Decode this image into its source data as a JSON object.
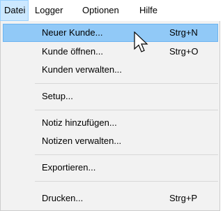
{
  "menubar": {
    "items": [
      {
        "label": "Datei",
        "active": true
      },
      {
        "label": "Logger",
        "active": false
      },
      {
        "label": "Optionen",
        "active": false
      },
      {
        "label": "Hilfe",
        "active": false
      }
    ]
  },
  "dropdown": {
    "items": [
      {
        "label": "Neuer Kunde...",
        "shortcut": "Strg+N",
        "highlighted": true
      },
      {
        "label": "Kunde öffnen...",
        "shortcut": "Strg+O"
      },
      {
        "label": "Kunden verwalten..."
      },
      {
        "label": "Setup..."
      },
      {
        "label": "Notiz hinzufügen..."
      },
      {
        "label": "Notizen verwalten..."
      },
      {
        "label": "Exportieren..."
      },
      {
        "label": "Drucken...",
        "shortcut": "Strg+P"
      }
    ]
  },
  "colors": {
    "highlight": "#91c9f7",
    "menubar_active": "#cce8ff",
    "menu_background": "#f2f2f2"
  },
  "icons": {
    "cursor": "arrow-pointer-icon"
  }
}
